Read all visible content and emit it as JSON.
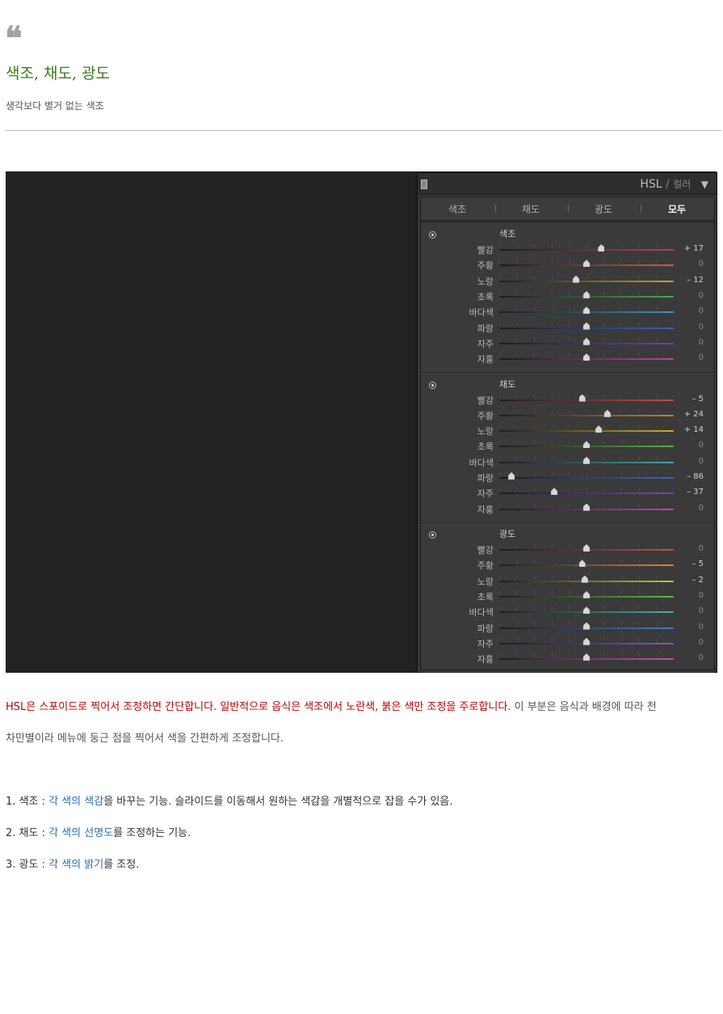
{
  "header": {
    "quote_mark": "❝",
    "title": "색조, 채도, 광도",
    "subtitle": "생각보다 별거 없는 색조"
  },
  "panel": {
    "title": "HSL",
    "separator": "/",
    "subtitle": "컬러",
    "collapse_icon": "triangle-down-icon",
    "tabs": [
      "색조",
      "채도",
      "광도",
      "모두"
    ],
    "active_tab": "모두",
    "sections": [
      {
        "label": "색조",
        "rows": [
          {
            "label": "빨강",
            "value": "+ 17",
            "num": 17
          },
          {
            "label": "주황",
            "value": "0",
            "num": 0
          },
          {
            "label": "노랑",
            "value": "– 12",
            "num": -12
          },
          {
            "label": "초록",
            "value": "0",
            "num": 0
          },
          {
            "label": "바다색",
            "value": "0",
            "num": 0
          },
          {
            "label": "파랑",
            "value": "0",
            "num": 0
          },
          {
            "label": "자주",
            "value": "0",
            "num": 0
          },
          {
            "label": "자홍",
            "value": "0",
            "num": 0
          }
        ]
      },
      {
        "label": "채도",
        "rows": [
          {
            "label": "빨강",
            "value": "– 5",
            "num": -5
          },
          {
            "label": "주황",
            "value": "+ 24",
            "num": 24
          },
          {
            "label": "노랑",
            "value": "+ 14",
            "num": 14
          },
          {
            "label": "초록",
            "value": "0",
            "num": 0
          },
          {
            "label": "바다색",
            "value": "0",
            "num": 0
          },
          {
            "label": "파랑",
            "value": "– 86",
            "num": -86
          },
          {
            "label": "자주",
            "value": "– 37",
            "num": -37
          },
          {
            "label": "자홍",
            "value": "0",
            "num": 0
          }
        ]
      },
      {
        "label": "광도",
        "rows": [
          {
            "label": "빨강",
            "value": "0",
            "num": 0
          },
          {
            "label": "주황",
            "value": "– 5",
            "num": -5
          },
          {
            "label": "노랑",
            "value": "– 2",
            "num": -2
          },
          {
            "label": "초록",
            "value": "0",
            "num": 0
          },
          {
            "label": "바다색",
            "value": "0",
            "num": 0
          },
          {
            "label": "파랑",
            "value": "0",
            "num": 0
          },
          {
            "label": "자주",
            "value": "0",
            "num": 0
          },
          {
            "label": "자홍",
            "value": "0",
            "num": 0
          }
        ]
      }
    ]
  },
  "body": {
    "para1_red": "HSL은 스포이드로 찍어서 조정하면 간단합니다. 일반적으로 음식은 색조에서 노란색, 붉은 색만 조정을 주로합니다.",
    "para1_gray": " 이 부분은 음식과 배경에 따라 천",
    "para2": "차만별이라 메뉴에 둥근 점을 찍어서 색을 간편하게 조정합니다.",
    "list": [
      {
        "prefix": "1. 색조 : ",
        "highlight": "각 색의 색감",
        "rest": "을 바꾸는 기능. 슬라이드를 이동해서 원하는 색감을 개별적으로 잡을 수가 있음."
      },
      {
        "prefix": "2. 채도 : ",
        "highlight": "각 색의 선명도",
        "rest": "를 조정하는 기능."
      },
      {
        "prefix": "3. 광도 : ",
        "highlight": "각 색의 밝기",
        "rest": "를 조정."
      }
    ]
  },
  "colors": {
    "title_green": "#3a7d1f",
    "highlight_red": "#c00000",
    "highlight_blue": "#2f6fb3",
    "section_tracks": [
      [
        "#b8406a",
        "#d0603a",
        "#b8a830",
        "#48a84a",
        "#3a9ab0",
        "#3a60c0",
        "#7040c0",
        "#c040a0"
      ],
      [
        "#c84a4a",
        "#d07a30",
        "#c8b030",
        "#5ab040",
        "#40a8a0",
        "#4060c8",
        "#8040c8",
        "#c840a8"
      ],
      [
        "#c84a4a",
        "#d08a40",
        "#c8c040",
        "#60b848",
        "#48b0a8",
        "#4878c8",
        "#9050c8",
        "#c850b0"
      ]
    ]
  }
}
